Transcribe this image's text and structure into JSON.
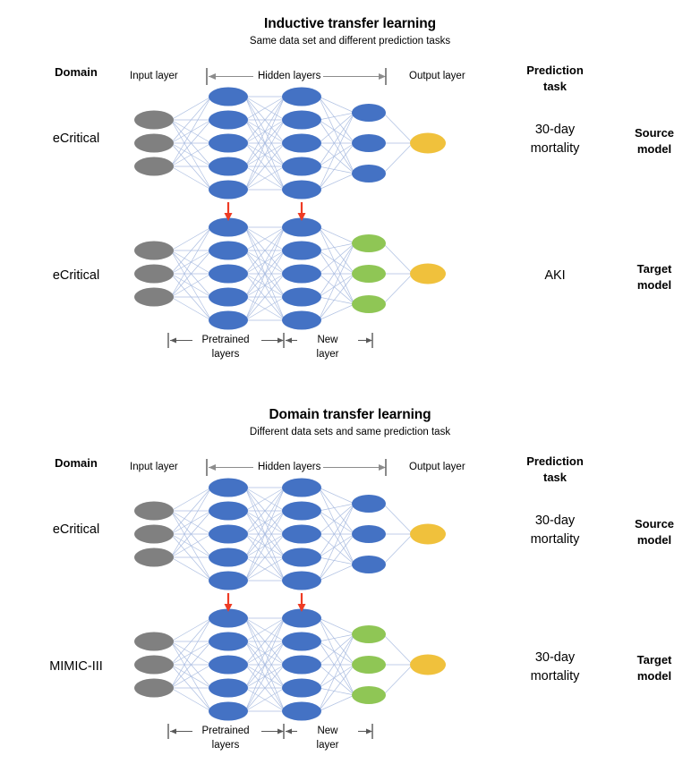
{
  "colors": {
    "input_node": "#808080",
    "hidden_node": "#4472C4",
    "new_node": "#8FC655",
    "output_node": "#F0C13C",
    "edge": "#A8BADF",
    "transfer_arrow": "#EE3B24",
    "bracket": "#595959"
  },
  "panels": [
    {
      "title": "Inductive transfer learning",
      "subtitle": "Same data set and different prediction tasks",
      "headers": {
        "domain": "Domain",
        "input_layer": "Input layer",
        "hidden_layers": "Hidden layers",
        "output_layer": "Output layer",
        "prediction_task_line1": "Prediction",
        "prediction_task_line2": "task"
      },
      "rows": [
        {
          "domain": "eCritical",
          "task_line1": "30-day",
          "task_line2": "mortality",
          "model_line1": "Source",
          "model_line2": "model"
        },
        {
          "domain": "eCritical",
          "task_line1": "AKI",
          "task_line2": "",
          "model_line1": "Target",
          "model_line2": "model"
        }
      ],
      "brackets": {
        "pretrained_line1": "Pretrained",
        "pretrained_line2": "layers",
        "new_line1": "New",
        "new_line2": "layer"
      }
    },
    {
      "title": "Domain transfer learning",
      "subtitle": "Different data sets and same prediction task",
      "headers": {
        "domain": "Domain",
        "input_layer": "Input layer",
        "hidden_layers": "Hidden layers",
        "output_layer": "Output layer",
        "prediction_task_line1": "Prediction",
        "prediction_task_line2": "task"
      },
      "rows": [
        {
          "domain": "eCritical",
          "task_line1": "30-day",
          "task_line2": "mortality",
          "model_line1": "Source",
          "model_line2": "model"
        },
        {
          "domain": "MIMIC-III",
          "task_line1": "30-day",
          "task_line2": "mortality",
          "model_line1": "Target",
          "model_line2": "model"
        }
      ],
      "brackets": {
        "pretrained_line1": "Pretrained",
        "pretrained_line2": "layers",
        "new_line1": "New",
        "new_line2": "layer"
      }
    }
  ],
  "network": {
    "layer_sizes": [
      3,
      5,
      5,
      3,
      1
    ],
    "source_layer_roles": [
      "input",
      "hidden",
      "hidden",
      "hidden",
      "output"
    ],
    "target_layer_roles": [
      "input",
      "hidden",
      "hidden",
      "new",
      "output"
    ]
  }
}
